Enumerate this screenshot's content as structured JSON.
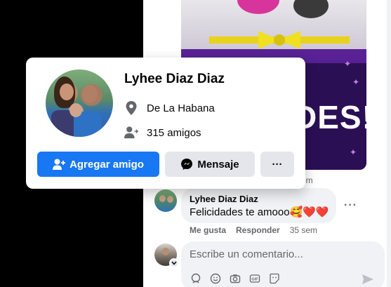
{
  "post": {
    "image_text": "DES!",
    "stars": [
      "✦",
      "✦",
      "✦"
    ]
  },
  "hover_card": {
    "name": "Lyhee Diaz Diaz",
    "location": "De La Habana",
    "friends": "315 amigos",
    "add_friend_label": "Agregar amigo",
    "message_label": "Mensaje",
    "more_label": "···"
  },
  "comment": {
    "partial_time": "sem",
    "author": "Lyhee Diaz Diaz",
    "text": "Felicidades te amooo🥰❤️❤️",
    "like_label": "Me gusta",
    "reply_label": "Responder",
    "time": "35 sem",
    "more_label": "···"
  },
  "composer": {
    "placeholder": "Escribe un comentario..."
  },
  "colors": {
    "primary": "#1877f2",
    "secondary_button": "#e4e6eb",
    "muted_text": "#65676b"
  },
  "icons": [
    "location-pin-icon",
    "friends-icon",
    "add-friend-icon",
    "messenger-icon",
    "more-icon",
    "avatar-sticker-icon",
    "emoji-icon",
    "camera-icon",
    "gif-icon",
    "sticker-icon",
    "send-icon",
    "chevron-down-icon"
  ]
}
